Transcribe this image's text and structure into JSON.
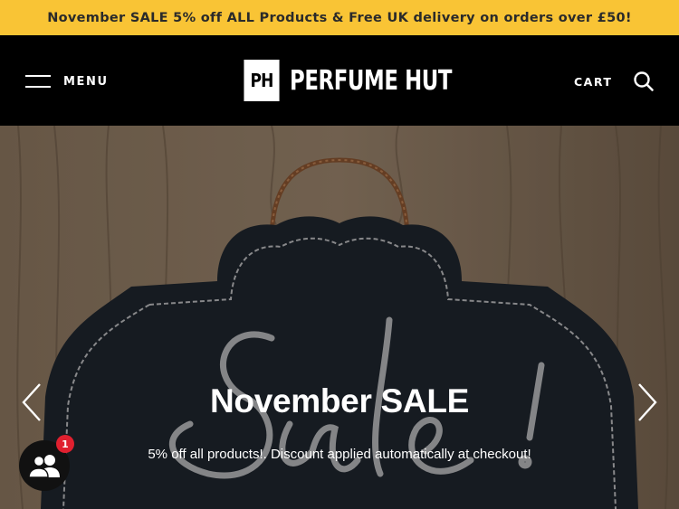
{
  "announcement": {
    "text": "November SALE 5% off ALL Products & Free UK delivery on orders over £50!"
  },
  "header": {
    "menu_label": "MENU",
    "logo_mark": "PH",
    "logo_text": "PERFUME HUT",
    "cart_label": "CART"
  },
  "hero": {
    "title": "November SALE",
    "subtitle": "5% off all products!. Discount applied automatically at checkout!"
  },
  "chat": {
    "badge_count": "1"
  },
  "colors": {
    "announcement_bg": "#f9c435",
    "header_bg": "#000000",
    "badge": "#e0202f"
  },
  "icons": [
    "hamburger-icon",
    "search-icon",
    "chevron-left-icon",
    "chevron-right-icon",
    "chat-people-icon"
  ]
}
